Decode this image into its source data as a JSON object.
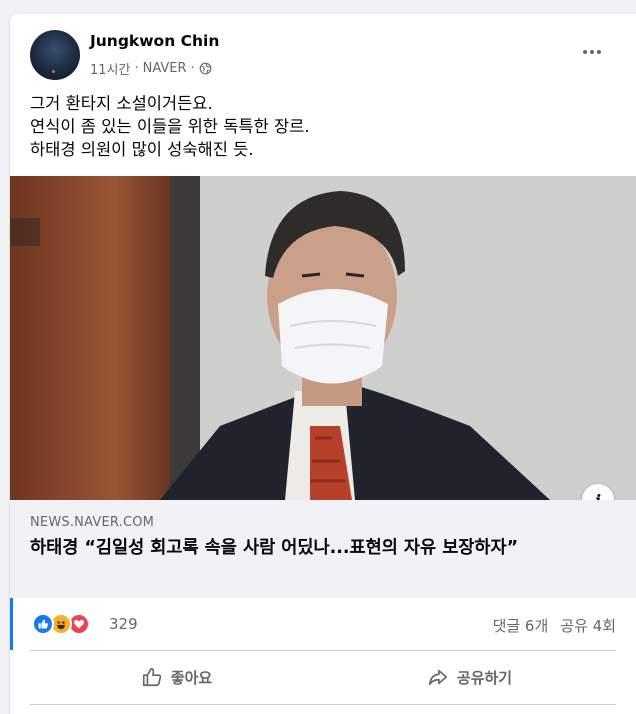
{
  "post": {
    "author": "Jungkwon Chin",
    "time": "11시간",
    "separator": " · ",
    "source": "NAVER",
    "separator2": " ·",
    "privacy_icon": "globe-icon",
    "text_lines": [
      "그거 환타지 소설이거든요.",
      "연식이 좀 있는 이들을 위한 독특한 장르.",
      "하태경 의원이 많이 성숙해진 듯."
    ]
  },
  "link": {
    "domain": "NEWS.NAVER.COM",
    "title": "하태경 “김일성 회고록 속을 사람 어딨나...표현의 자유 보장하자”",
    "info_label": "i"
  },
  "reactions": {
    "icons": [
      "like-icon",
      "haha-icon",
      "love-icon"
    ],
    "count": "329",
    "comments": "댓글 6개",
    "shares": "공유 4회"
  },
  "actions": {
    "like_label": "좋아요",
    "share_label": "공유하기"
  },
  "colors": {
    "accent": "#1877f2",
    "text_secondary": "#65676b",
    "card_bg": "#ffffff",
    "page_bg": "#f0f2f5"
  }
}
